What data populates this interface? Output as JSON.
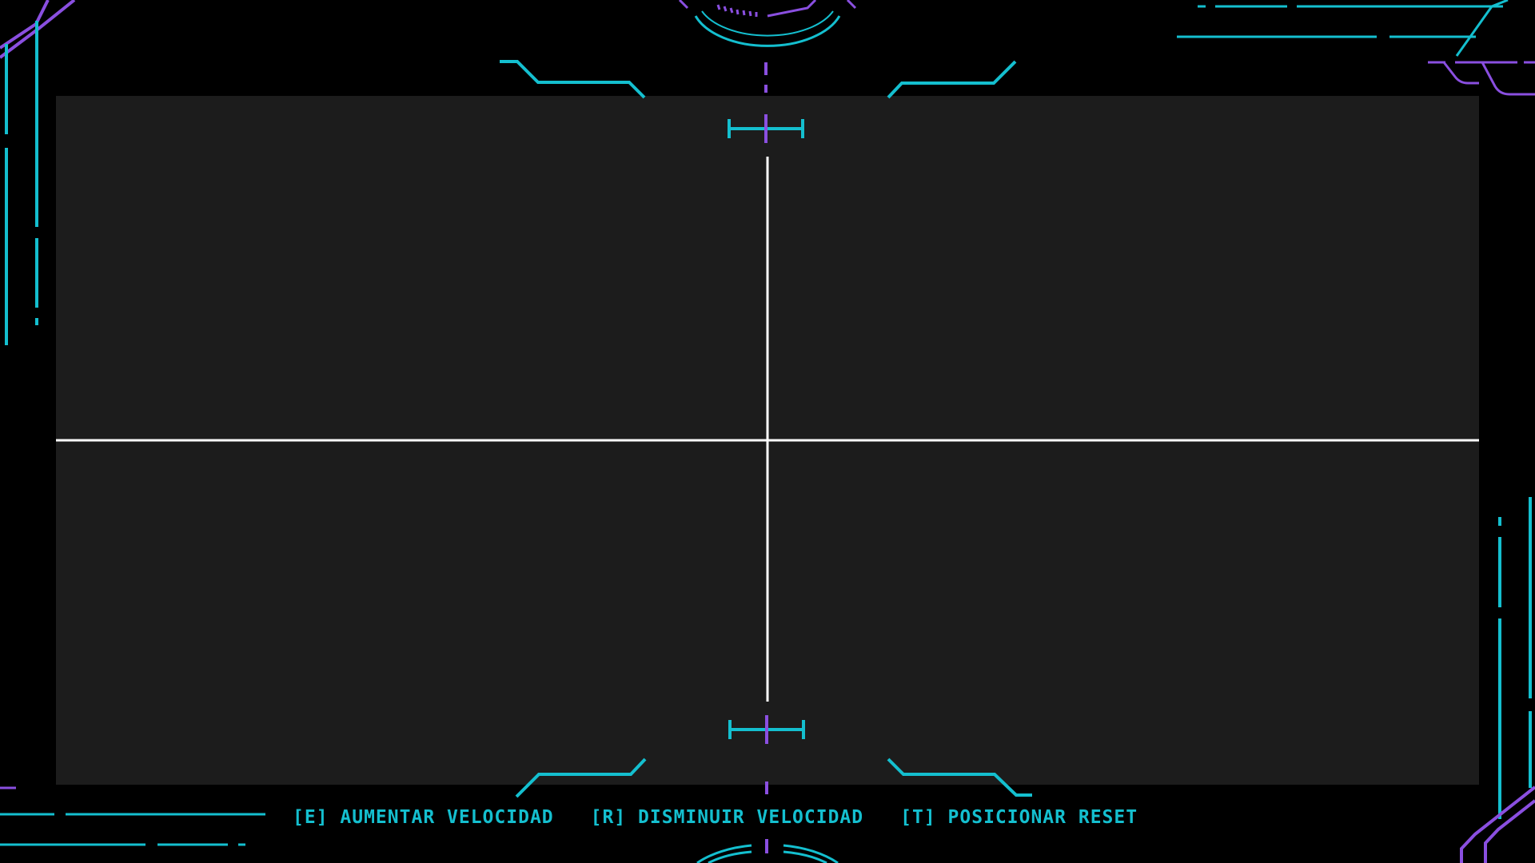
{
  "theme": {
    "background": "#000000",
    "viewport": "#1c1c1c",
    "cyan": "#14bfcf",
    "violet": "#8a4fe0",
    "crosshair": "#ffffff"
  },
  "controls": [
    {
      "key": "E",
      "label": "[E] AUMENTAR VELOCIDAD"
    },
    {
      "key": "R",
      "label": "[R] DISMINUIR VELOCIDAD"
    },
    {
      "key": "T",
      "label": "[T] POSICIONAR RESET"
    }
  ]
}
